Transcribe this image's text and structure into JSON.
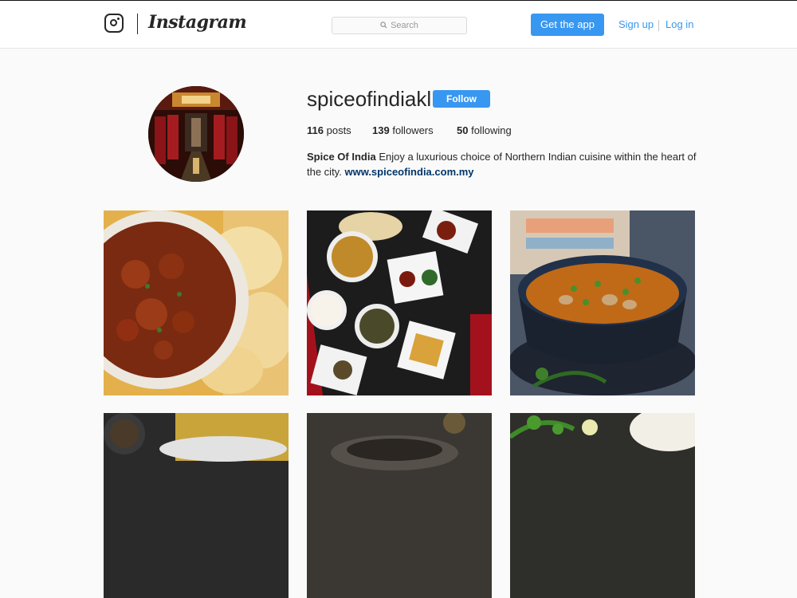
{
  "header": {
    "wordmark": "Instagram",
    "search_placeholder": "Search",
    "get_app_label": "Get the app",
    "sign_up_label": "Sign up",
    "log_in_label": "Log in"
  },
  "profile": {
    "username": "spiceofindiakl",
    "follow_label": "Follow",
    "stats": {
      "posts_count": "116",
      "posts_label": "posts",
      "followers_count": "139",
      "followers_label": "followers",
      "following_count": "50",
      "following_label": "following"
    },
    "bio": {
      "name": "Spice Of India",
      "text": "Enjoy a luxurious choice of Northern Indian cuisine within the heart of the city.",
      "link": "www.spiceofindia.com.my"
    }
  },
  "posts": [
    {
      "subject": "butter chicken curry with naan"
    },
    {
      "subject": "thali spread of dishes"
    },
    {
      "subject": "green pea and mushroom curry"
    },
    {
      "subject": "spice bowl"
    },
    {
      "subject": "dish in pan"
    },
    {
      "subject": "rice with herbs and lemon"
    }
  ],
  "colors": {
    "accent": "#3897f0",
    "link": "#003569",
    "background": "#fafafa"
  },
  "icons": {
    "logo": "camera-icon",
    "search": "search-icon"
  }
}
